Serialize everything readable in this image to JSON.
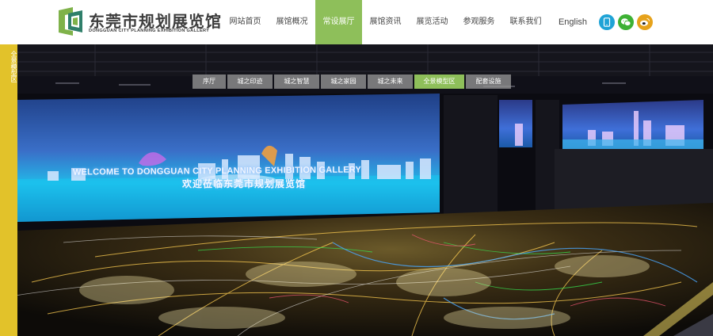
{
  "header": {
    "logo": {
      "title_cn": "东莞市规划展览馆",
      "title_en": "DONGGUAN  CITY  PLANNING  EXHIBITION  GALLERY"
    },
    "nav": [
      {
        "label": "网站首页"
      },
      {
        "label": "展馆概况"
      },
      {
        "label": "常设展厅",
        "active": true
      },
      {
        "label": "展馆资讯"
      },
      {
        "label": "展览活动"
      },
      {
        "label": "参观服务"
      },
      {
        "label": "联系我们"
      }
    ],
    "lang_label": "English",
    "social": [
      {
        "icon": "phone-icon",
        "color": "#1fa3d6"
      },
      {
        "icon": "wechat-icon",
        "color": "#3db134"
      },
      {
        "icon": "weibo-icon",
        "color": "#e6a21b"
      }
    ]
  },
  "banner": {
    "side_tab_label": "全景模型区",
    "subnav": [
      {
        "label": "序厅"
      },
      {
        "label": "城之印迹"
      },
      {
        "label": "城之智慧"
      },
      {
        "label": "城之家园"
      },
      {
        "label": "城之未来"
      },
      {
        "label": "全景模型区",
        "active": true
      },
      {
        "label": "配套设施"
      }
    ],
    "screen_title_en": "WELCOME TO DONGGUAN CITY PLANNING EXHIBITION GALLERY",
    "screen_title_cn": "欢迎莅临东莞市规划展览馆"
  },
  "colors": {
    "accent_green": "#8ebf5a",
    "side_tab_yellow": "#e2c22a"
  }
}
